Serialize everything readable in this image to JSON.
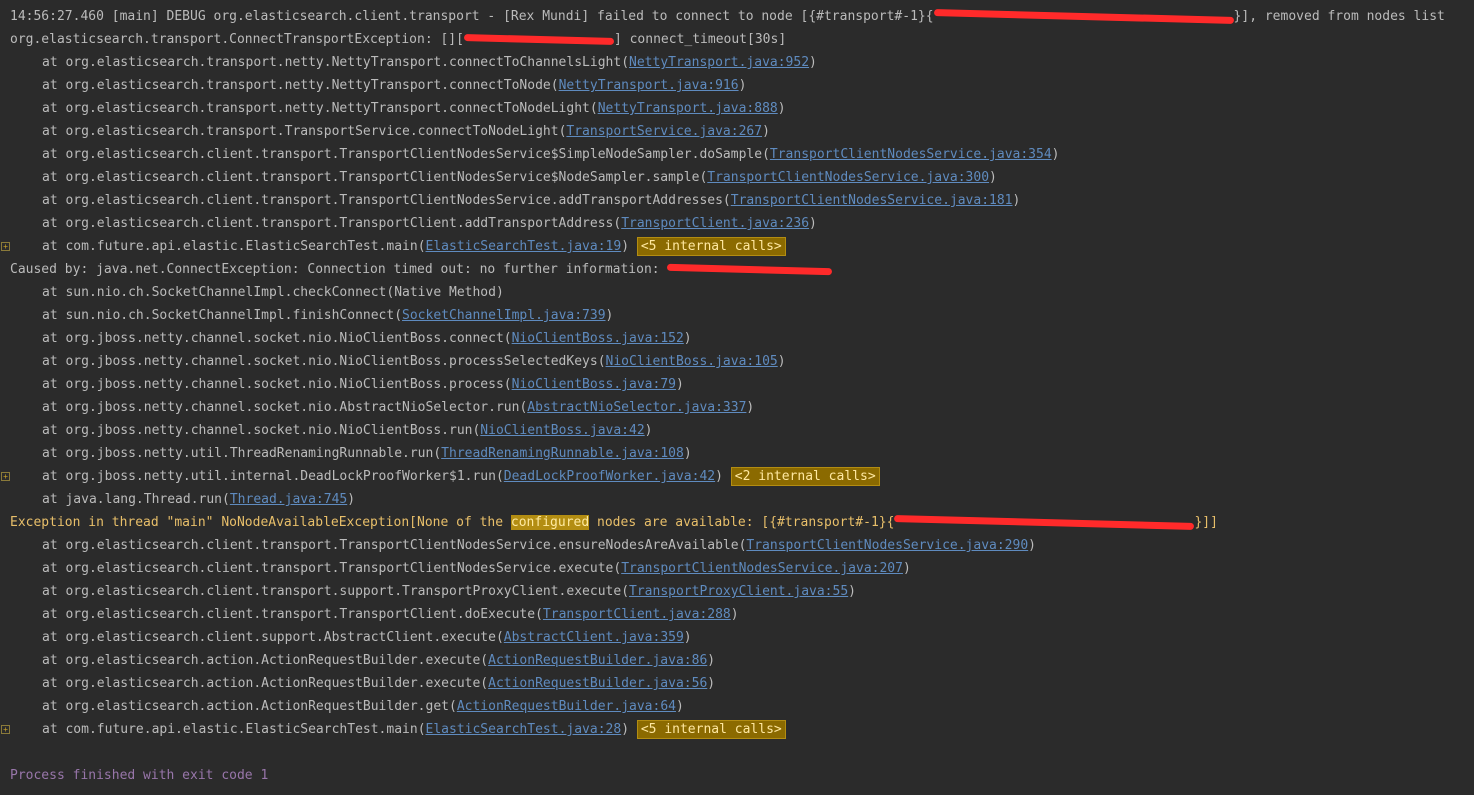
{
  "console": {
    "header": {
      "prefix": "14:56:27.460 [main] DEBUG org.elasticsearch.client.transport - [Rex Mundi] failed to connect to node [{#transport#-1}{",
      "suffix": "}], removed from nodes list"
    },
    "exception1": {
      "prefix": "org.elasticsearch.transport.ConnectTransportException: [][",
      "suffix": "] connect_timeout[30s]"
    },
    "frames1": [
      {
        "method": "at org.elasticsearch.transport.netty.NettyTransport.connectToChannelsLight",
        "file": "NettyTransport.java:952"
      },
      {
        "method": "at org.elasticsearch.transport.netty.NettyTransport.connectToNode",
        "file": "NettyTransport.java:916"
      },
      {
        "method": "at org.elasticsearch.transport.netty.NettyTransport.connectToNodeLight",
        "file": "NettyTransport.java:888"
      },
      {
        "method": "at org.elasticsearch.transport.TransportService.connectToNodeLight",
        "file": "TransportService.java:267"
      },
      {
        "method": "at org.elasticsearch.client.transport.TransportClientNodesService$SimpleNodeSampler.doSample",
        "file": "TransportClientNodesService.java:354"
      },
      {
        "method": "at org.elasticsearch.client.transport.TransportClientNodesService$NodeSampler.sample",
        "file": "TransportClientNodesService.java:300"
      },
      {
        "method": "at org.elasticsearch.client.transport.TransportClientNodesService.addTransportAddresses",
        "file": "TransportClientNodesService.java:181"
      },
      {
        "method": "at org.elasticsearch.client.transport.TransportClient.addTransportAddress",
        "file": "TransportClient.java:236"
      },
      {
        "method": "at com.future.api.elastic.ElasticSearchTest.main",
        "file": "ElasticSearchTest.java:19",
        "badge": "<5 internal calls>"
      }
    ],
    "caused_by": "Caused by: java.net.ConnectException: Connection timed out: no further information: ",
    "frames2": [
      {
        "method": "at sun.nio.ch.SocketChannelImpl.checkConnect",
        "plain": "(Native Method)"
      },
      {
        "method": "at sun.nio.ch.SocketChannelImpl.finishConnect",
        "file": "SocketChannelImpl.java:739"
      },
      {
        "method": "at org.jboss.netty.channel.socket.nio.NioClientBoss.connect",
        "file": "NioClientBoss.java:152"
      },
      {
        "method": "at org.jboss.netty.channel.socket.nio.NioClientBoss.processSelectedKeys",
        "file": "NioClientBoss.java:105"
      },
      {
        "method": "at org.jboss.netty.channel.socket.nio.NioClientBoss.process",
        "file": "NioClientBoss.java:79"
      },
      {
        "method": "at org.jboss.netty.channel.socket.nio.AbstractNioSelector.run",
        "file": "AbstractNioSelector.java:337"
      },
      {
        "method": "at org.jboss.netty.channel.socket.nio.NioClientBoss.run",
        "file": "NioClientBoss.java:42"
      },
      {
        "method": "at org.jboss.netty.util.ThreadRenamingRunnable.run",
        "file": "ThreadRenamingRunnable.java:108"
      },
      {
        "method": "at org.jboss.netty.util.internal.DeadLockProofWorker$1.run",
        "file": "DeadLockProofWorker.java:42",
        "badge": "<2 internal calls>"
      },
      {
        "method": "at java.lang.Thread.run",
        "file": "Thread.java:745"
      }
    ],
    "exception2": {
      "prefix": "Exception in thread \"main\" NoNodeAvailableException[None of the ",
      "highlight": "configured",
      "middle": " nodes are available: [{#transport#-1}{",
      "suffix": "}]]"
    },
    "frames3": [
      {
        "method": "at org.elasticsearch.client.transport.TransportClientNodesService.ensureNodesAreAvailable",
        "file": "TransportClientNodesService.java:290"
      },
      {
        "method": "at org.elasticsearch.client.transport.TransportClientNodesService.execute",
        "file": "TransportClientNodesService.java:207"
      },
      {
        "method": "at org.elasticsearch.client.transport.support.TransportProxyClient.execute",
        "file": "TransportProxyClient.java:55"
      },
      {
        "method": "at org.elasticsearch.client.transport.TransportClient.doExecute",
        "file": "TransportClient.java:288"
      },
      {
        "method": "at org.elasticsearch.client.support.AbstractClient.execute",
        "file": "AbstractClient.java:359"
      },
      {
        "method": "at org.elasticsearch.action.ActionRequestBuilder.execute",
        "file": "ActionRequestBuilder.java:86"
      },
      {
        "method": "at org.elasticsearch.action.ActionRequestBuilder.execute",
        "file": "ActionRequestBuilder.java:56"
      },
      {
        "method": "at org.elasticsearch.action.ActionRequestBuilder.get",
        "file": "ActionRequestBuilder.java:64"
      },
      {
        "method": "at com.future.api.elastic.ElasticSearchTest.main",
        "file": "ElasticSearchTest.java:28",
        "badge": "<5 internal calls>"
      }
    ],
    "exit_message": "Process finished with exit code 1",
    "fold_glyph": "+",
    "colors": {
      "background": "#2b2b2b",
      "text": "#bbbbbb",
      "error": "#e8bf6a",
      "link": "#5f8bbf",
      "badge": "#8b6a00",
      "exit": "#9876aa",
      "redaction": "#ff2a2a"
    }
  }
}
